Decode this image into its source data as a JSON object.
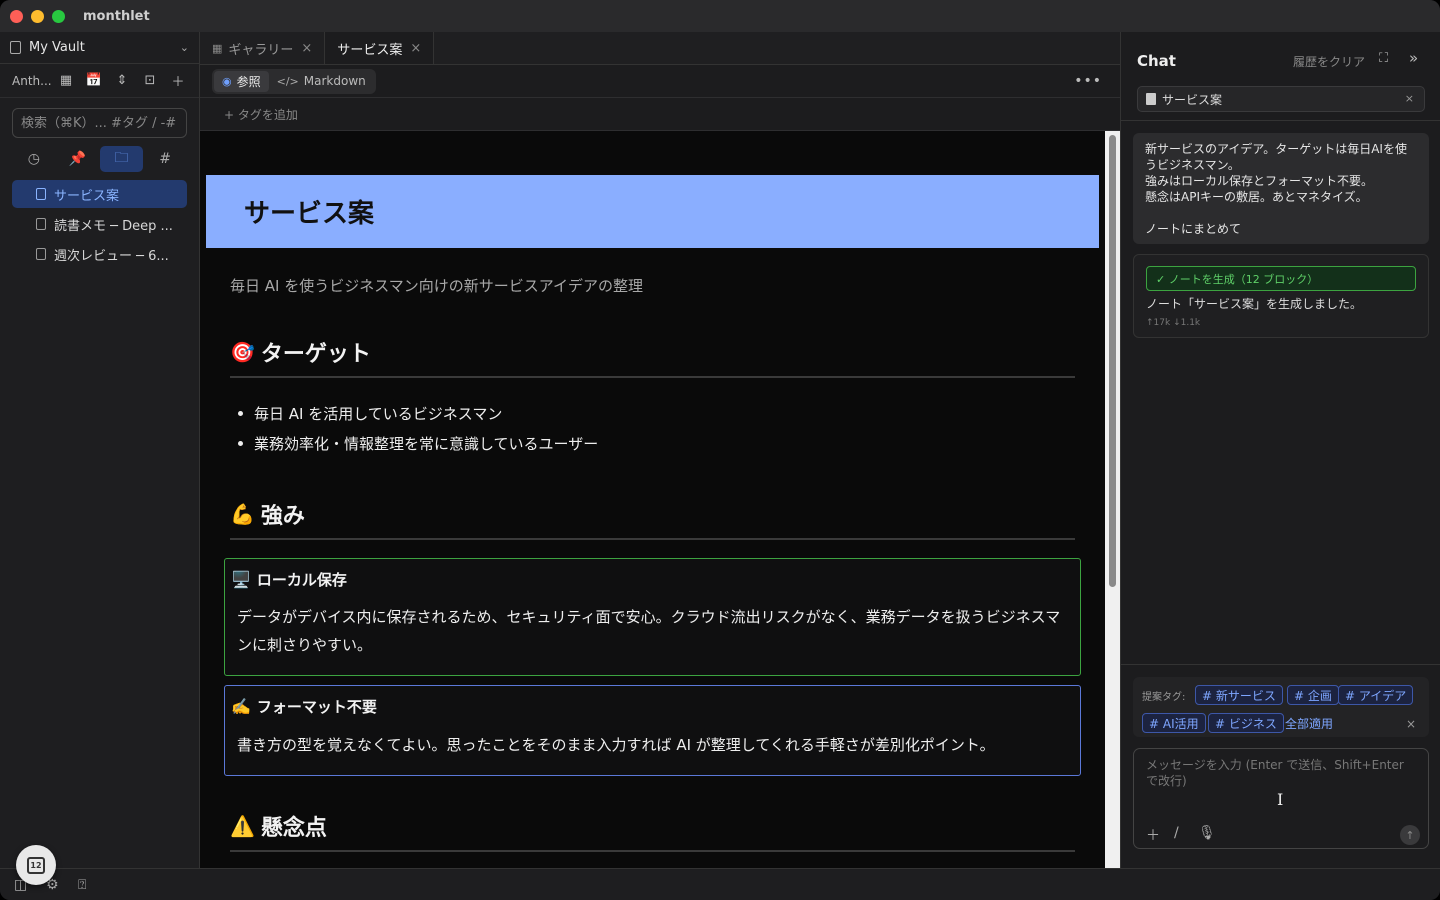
{
  "app": {
    "title": "monthlet"
  },
  "sidebar": {
    "vault_name": "My Vault",
    "toolbar_label": "Anth...",
    "search_placeholder": "検索（⌘K）... #タグ / -#",
    "files": [
      {
        "label": "サービス案",
        "active": true
      },
      {
        "label": "読書メモ ─ Deep ...",
        "active": false
      },
      {
        "label": "週次レビュー ─ 6...",
        "active": false
      }
    ],
    "calendar_day": "12"
  },
  "tabs": [
    {
      "label": "ギャラリー",
      "active": false
    },
    {
      "label": "サービス案",
      "active": true
    }
  ],
  "view": {
    "read_label": "参照",
    "markdown_label": "Markdown",
    "add_tag_label": "+ タグを追加"
  },
  "document": {
    "title": "サービス案",
    "subtitle": "毎日 AI を使うビジネスマン向けの新サービスアイデアの整理",
    "section_target": {
      "emoji": "🎯",
      "heading": "ターゲット"
    },
    "target_items": [
      "毎日 AI を活用しているビジネスマン",
      "業務効率化・情報整理を常に意識しているユーザー"
    ],
    "section_strength": {
      "emoji": "💪",
      "heading": "強み"
    },
    "callout_local": {
      "emoji": "🖥️",
      "title": "ローカル保存",
      "body": "データがデバイス内に保存されるため、セキュリティ面で安心。クラウド流出リスクがなく、業務データを扱うビジネスマンに刺さりやすい。"
    },
    "callout_format": {
      "emoji": "✍️",
      "title": "フォーマット不要",
      "body": "書き方の型を覚えなくてよい。思ったことをそのまま入力すれば AI が整理してくれる手軽さが差別化ポイント。"
    },
    "section_concern": {
      "emoji": "⚠️",
      "heading": "懸念点"
    }
  },
  "chat": {
    "title": "Chat",
    "clear_label": "履歴をクリア",
    "context_doc": "サービス案",
    "user_message_lines": [
      "新サービスのアイデア。ターゲットは毎日AIを使",
      "うビジネスマン。",
      "強みはローカル保存とフォーマット不要。",
      "懸念はAPIキーの敷居。あとマネタイズ。",
      "",
      "ノートにまとめて"
    ],
    "ai_badge": "✓ ノートを生成（12 ブロック）",
    "ai_text": "ノート「サービス案」を生成しました。",
    "ai_tokens": "↑17k ↓1.1k",
    "suggest_label": "提案タグ:",
    "suggested_tags": [
      "# 新サービス",
      "# 企画",
      "# アイデア",
      "# AI活用",
      "# ビジネス"
    ],
    "apply_all_label": "全部適用",
    "input_placeholder": "メッセージを入力 (Enter で送信、Shift+Enter で改行)"
  }
}
